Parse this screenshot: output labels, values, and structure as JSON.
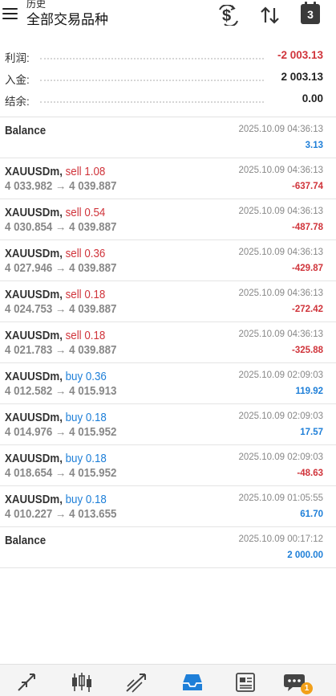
{
  "header": {
    "subtitle": "历史",
    "title": "全部交易品种",
    "calendar_day": "3",
    "icons": [
      "menu-icon",
      "dollar-refresh-icon",
      "sort-icon",
      "calendar-icon"
    ]
  },
  "summary": [
    {
      "label": "利润:",
      "value": "-2 003.13",
      "tone": "neg"
    },
    {
      "label": "入金:",
      "value": "2 003.13",
      "tone": "neutral"
    },
    {
      "label": "结余:",
      "value": "0.00",
      "tone": "neutral"
    }
  ],
  "rows": [
    {
      "symbol": "Balance",
      "side": "",
      "side_type": "",
      "prices": "",
      "time": "2025.10.09 04:36:13",
      "profit": "3.13",
      "tone": "pos"
    },
    {
      "symbol": "XAUUSDm,",
      "side": "sell 1.08",
      "side_type": "sell",
      "prices": "4 033.982 → 4 039.887",
      "time": "2025.10.09 04:36:13",
      "profit": "-637.74",
      "tone": "neg"
    },
    {
      "symbol": "XAUUSDm,",
      "side": "sell 0.54",
      "side_type": "sell",
      "prices": "4 030.854 → 4 039.887",
      "time": "2025.10.09 04:36:13",
      "profit": "-487.78",
      "tone": "neg"
    },
    {
      "symbol": "XAUUSDm,",
      "side": "sell 0.36",
      "side_type": "sell",
      "prices": "4 027.946 → 4 039.887",
      "time": "2025.10.09 04:36:13",
      "profit": "-429.87",
      "tone": "neg"
    },
    {
      "symbol": "XAUUSDm,",
      "side": "sell 0.18",
      "side_type": "sell",
      "prices": "4 024.753 → 4 039.887",
      "time": "2025.10.09 04:36:13",
      "profit": "-272.42",
      "tone": "neg"
    },
    {
      "symbol": "XAUUSDm,",
      "side": "sell 0.18",
      "side_type": "sell",
      "prices": "4 021.783 → 4 039.887",
      "time": "2025.10.09 04:36:13",
      "profit": "-325.88",
      "tone": "neg"
    },
    {
      "symbol": "XAUUSDm,",
      "side": "buy 0.36",
      "side_type": "buy",
      "prices": "4 012.582 → 4 015.913",
      "time": "2025.10.09 02:09:03",
      "profit": "119.92",
      "tone": "pos"
    },
    {
      "symbol": "XAUUSDm,",
      "side": "buy 0.18",
      "side_type": "buy",
      "prices": "4 014.976 → 4 015.952",
      "time": "2025.10.09 02:09:03",
      "profit": "17.57",
      "tone": "pos"
    },
    {
      "symbol": "XAUUSDm,",
      "side": "buy 0.18",
      "side_type": "buy",
      "prices": "4 018.654 → 4 015.952",
      "time": "2025.10.09 02:09:03",
      "profit": "-48.63",
      "tone": "neg"
    },
    {
      "symbol": "XAUUSDm,",
      "side": "buy 0.18",
      "side_type": "buy",
      "prices": "4 010.227 → 4 013.655",
      "time": "2025.10.09 01:05:55",
      "profit": "61.70",
      "tone": "pos"
    },
    {
      "symbol": "Balance",
      "side": "",
      "side_type": "",
      "prices": "",
      "time": "2025.10.09 00:17:12",
      "profit": "2 000.00",
      "tone": "pos"
    }
  ],
  "bottom_nav": {
    "items": [
      "quotes-icon",
      "chart-icon",
      "trade-icon",
      "history-icon",
      "news-icon",
      "messages-icon"
    ],
    "active": "history-icon",
    "messages_badge": "1"
  },
  "colors": {
    "sell": "#d0343b",
    "buy": "#1e7fd8",
    "active_nav": "#1e7fd8",
    "badge": "#f2a01a"
  }
}
